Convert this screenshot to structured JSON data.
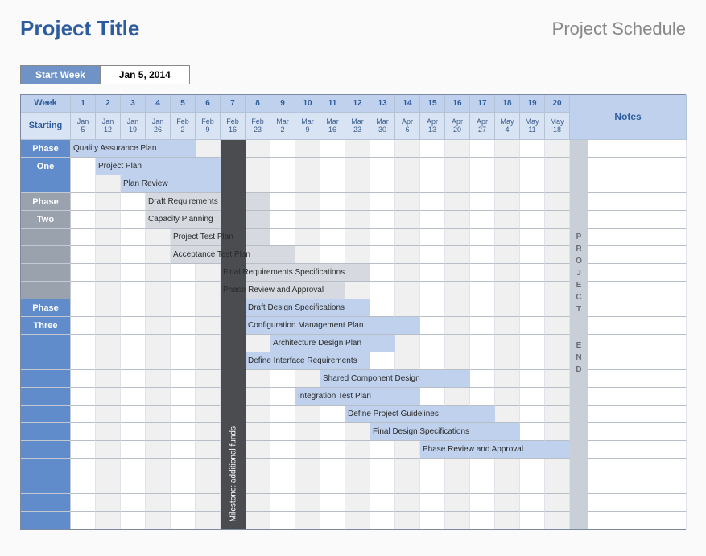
{
  "header": {
    "title": "Project Title",
    "subtitle": "Project Schedule"
  },
  "start_week": {
    "label": "Start Week",
    "value": "Jan 5, 2014"
  },
  "columns": {
    "week_label": "Week",
    "starting_label": "Starting",
    "notes_label": "Notes",
    "weeks": [
      "1",
      "2",
      "3",
      "4",
      "5",
      "6",
      "7",
      "8",
      "9",
      "10",
      "11",
      "12",
      "13",
      "14",
      "15",
      "16",
      "17",
      "18",
      "19",
      "20"
    ],
    "dates": [
      {
        "m": "Jan",
        "d": "5"
      },
      {
        "m": "Jan",
        "d": "12"
      },
      {
        "m": "Jan",
        "d": "19"
      },
      {
        "m": "Jan",
        "d": "26"
      },
      {
        "m": "Feb",
        "d": "2"
      },
      {
        "m": "Feb",
        "d": "9"
      },
      {
        "m": "Feb",
        "d": "16"
      },
      {
        "m": "Feb",
        "d": "23"
      },
      {
        "m": "Mar",
        "d": "2"
      },
      {
        "m": "Mar",
        "d": "9"
      },
      {
        "m": "Mar",
        "d": "16"
      },
      {
        "m": "Mar",
        "d": "23"
      },
      {
        "m": "Mar",
        "d": "30"
      },
      {
        "m": "Apr",
        "d": "6"
      },
      {
        "m": "Apr",
        "d": "13"
      },
      {
        "m": "Apr",
        "d": "20"
      },
      {
        "m": "Apr",
        "d": "27"
      },
      {
        "m": "May",
        "d": "4"
      },
      {
        "m": "May",
        "d": "11"
      },
      {
        "m": "May",
        "d": "18"
      }
    ]
  },
  "phases": {
    "one_l1": "Phase",
    "one_l2": "One",
    "two_l1": "Phase",
    "two_l2": "Two",
    "three_l1": "Phase",
    "three_l2": "Three"
  },
  "milestone": "Milestone: additional funds",
  "project_end": "PROJECT END",
  "tasks": [
    {
      "row": 0,
      "start": 1,
      "end": 5,
      "color": "blue",
      "label": "Quality Assurance Plan"
    },
    {
      "row": 1,
      "start": 2,
      "end": 6,
      "color": "blue",
      "label": "Project Plan"
    },
    {
      "row": 2,
      "start": 3,
      "end": 7,
      "color": "blue",
      "label": "Plan Review"
    },
    {
      "row": 3,
      "start": 4,
      "end": 8,
      "color": "gray",
      "label": "Draft Requirements"
    },
    {
      "row": 4,
      "start": 4,
      "end": 8,
      "color": "gray",
      "label": "Capacity Planning"
    },
    {
      "row": 5,
      "start": 5,
      "end": 8,
      "color": "gray",
      "label": "Project Test Plan"
    },
    {
      "row": 6,
      "start": 5,
      "end": 9,
      "color": "gray",
      "label": "Acceptance Test Plan"
    },
    {
      "row": 7,
      "start": 7,
      "end": 12,
      "color": "gray",
      "label": "Final Requirements Specifications"
    },
    {
      "row": 8,
      "start": 7,
      "end": 11,
      "color": "gray",
      "label": "Phase Review and Approval"
    },
    {
      "row": 9,
      "start": 8,
      "end": 12,
      "color": "blue",
      "label": "Draft Design Specifications"
    },
    {
      "row": 10,
      "start": 8,
      "end": 14,
      "color": "blue",
      "label": "Configuration Management Plan"
    },
    {
      "row": 11,
      "start": 9,
      "end": 13,
      "color": "blue",
      "label": "Architecture Design Plan"
    },
    {
      "row": 12,
      "start": 8,
      "end": 12,
      "color": "blue",
      "label": "Define Interface Requirements"
    },
    {
      "row": 13,
      "start": 11,
      "end": 16,
      "color": "blue",
      "label": "Shared Component Design"
    },
    {
      "row": 14,
      "start": 10,
      "end": 14,
      "color": "blue",
      "label": "Integration Test Plan"
    },
    {
      "row": 15,
      "start": 12,
      "end": 17,
      "color": "blue",
      "label": "Define Project Guidelines"
    },
    {
      "row": 16,
      "start": 13,
      "end": 18,
      "color": "blue",
      "label": "Final Design Specifications"
    },
    {
      "row": 17,
      "start": 15,
      "end": 20,
      "color": "blue",
      "label": "Phase Review and Approval"
    }
  ],
  "chart_data": {
    "type": "gantt",
    "title": "Project Schedule",
    "x": [
      "Jan 5",
      "Jan 12",
      "Jan 19",
      "Jan 26",
      "Feb 2",
      "Feb 9",
      "Feb 16",
      "Feb 23",
      "Mar 2",
      "Mar 9",
      "Mar 16",
      "Mar 23",
      "Mar 30",
      "Apr 6",
      "Apr 13",
      "Apr 20",
      "Apr 27",
      "May 4",
      "May 11",
      "May 18"
    ],
    "phases": [
      {
        "name": "Phase One",
        "rows": [
          0,
          1,
          2
        ]
      },
      {
        "name": "Phase Two",
        "rows": [
          3,
          4,
          5,
          6,
          7,
          8
        ]
      },
      {
        "name": "Phase Three",
        "rows": [
          9,
          10,
          11,
          12,
          13,
          14,
          15,
          16,
          17
        ]
      }
    ],
    "milestone": {
      "week": 7,
      "label": "Milestone: additional funds"
    },
    "project_end": {
      "week": 20,
      "label": "PROJECT END"
    },
    "series": [
      {
        "name": "Quality Assurance Plan",
        "start_week": 1,
        "end_week": 5,
        "phase": "Phase One"
      },
      {
        "name": "Project Plan",
        "start_week": 2,
        "end_week": 6,
        "phase": "Phase One"
      },
      {
        "name": "Plan Review",
        "start_week": 3,
        "end_week": 7,
        "phase": "Phase One"
      },
      {
        "name": "Draft Requirements",
        "start_week": 4,
        "end_week": 8,
        "phase": "Phase Two"
      },
      {
        "name": "Capacity Planning",
        "start_week": 4,
        "end_week": 8,
        "phase": "Phase Two"
      },
      {
        "name": "Project Test Plan",
        "start_week": 5,
        "end_week": 8,
        "phase": "Phase Two"
      },
      {
        "name": "Acceptance Test Plan",
        "start_week": 5,
        "end_week": 9,
        "phase": "Phase Two"
      },
      {
        "name": "Final Requirements Specifications",
        "start_week": 7,
        "end_week": 12,
        "phase": "Phase Two"
      },
      {
        "name": "Phase Review and Approval",
        "start_week": 7,
        "end_week": 11,
        "phase": "Phase Two"
      },
      {
        "name": "Draft Design Specifications",
        "start_week": 8,
        "end_week": 12,
        "phase": "Phase Three"
      },
      {
        "name": "Configuration Management Plan",
        "start_week": 8,
        "end_week": 14,
        "phase": "Phase Three"
      },
      {
        "name": "Architecture Design Plan",
        "start_week": 9,
        "end_week": 13,
        "phase": "Phase Three"
      },
      {
        "name": "Define Interface Requirements",
        "start_week": 8,
        "end_week": 12,
        "phase": "Phase Three"
      },
      {
        "name": "Shared Component Design",
        "start_week": 11,
        "end_week": 16,
        "phase": "Phase Three"
      },
      {
        "name": "Integration Test Plan",
        "start_week": 10,
        "end_week": 14,
        "phase": "Phase Three"
      },
      {
        "name": "Define Project Guidelines",
        "start_week": 12,
        "end_week": 17,
        "phase": "Phase Three"
      },
      {
        "name": "Final Design Specifications",
        "start_week": 13,
        "end_week": 18,
        "phase": "Phase Three"
      },
      {
        "name": "Phase Review and Approval",
        "start_week": 15,
        "end_week": 20,
        "phase": "Phase Three"
      }
    ]
  }
}
